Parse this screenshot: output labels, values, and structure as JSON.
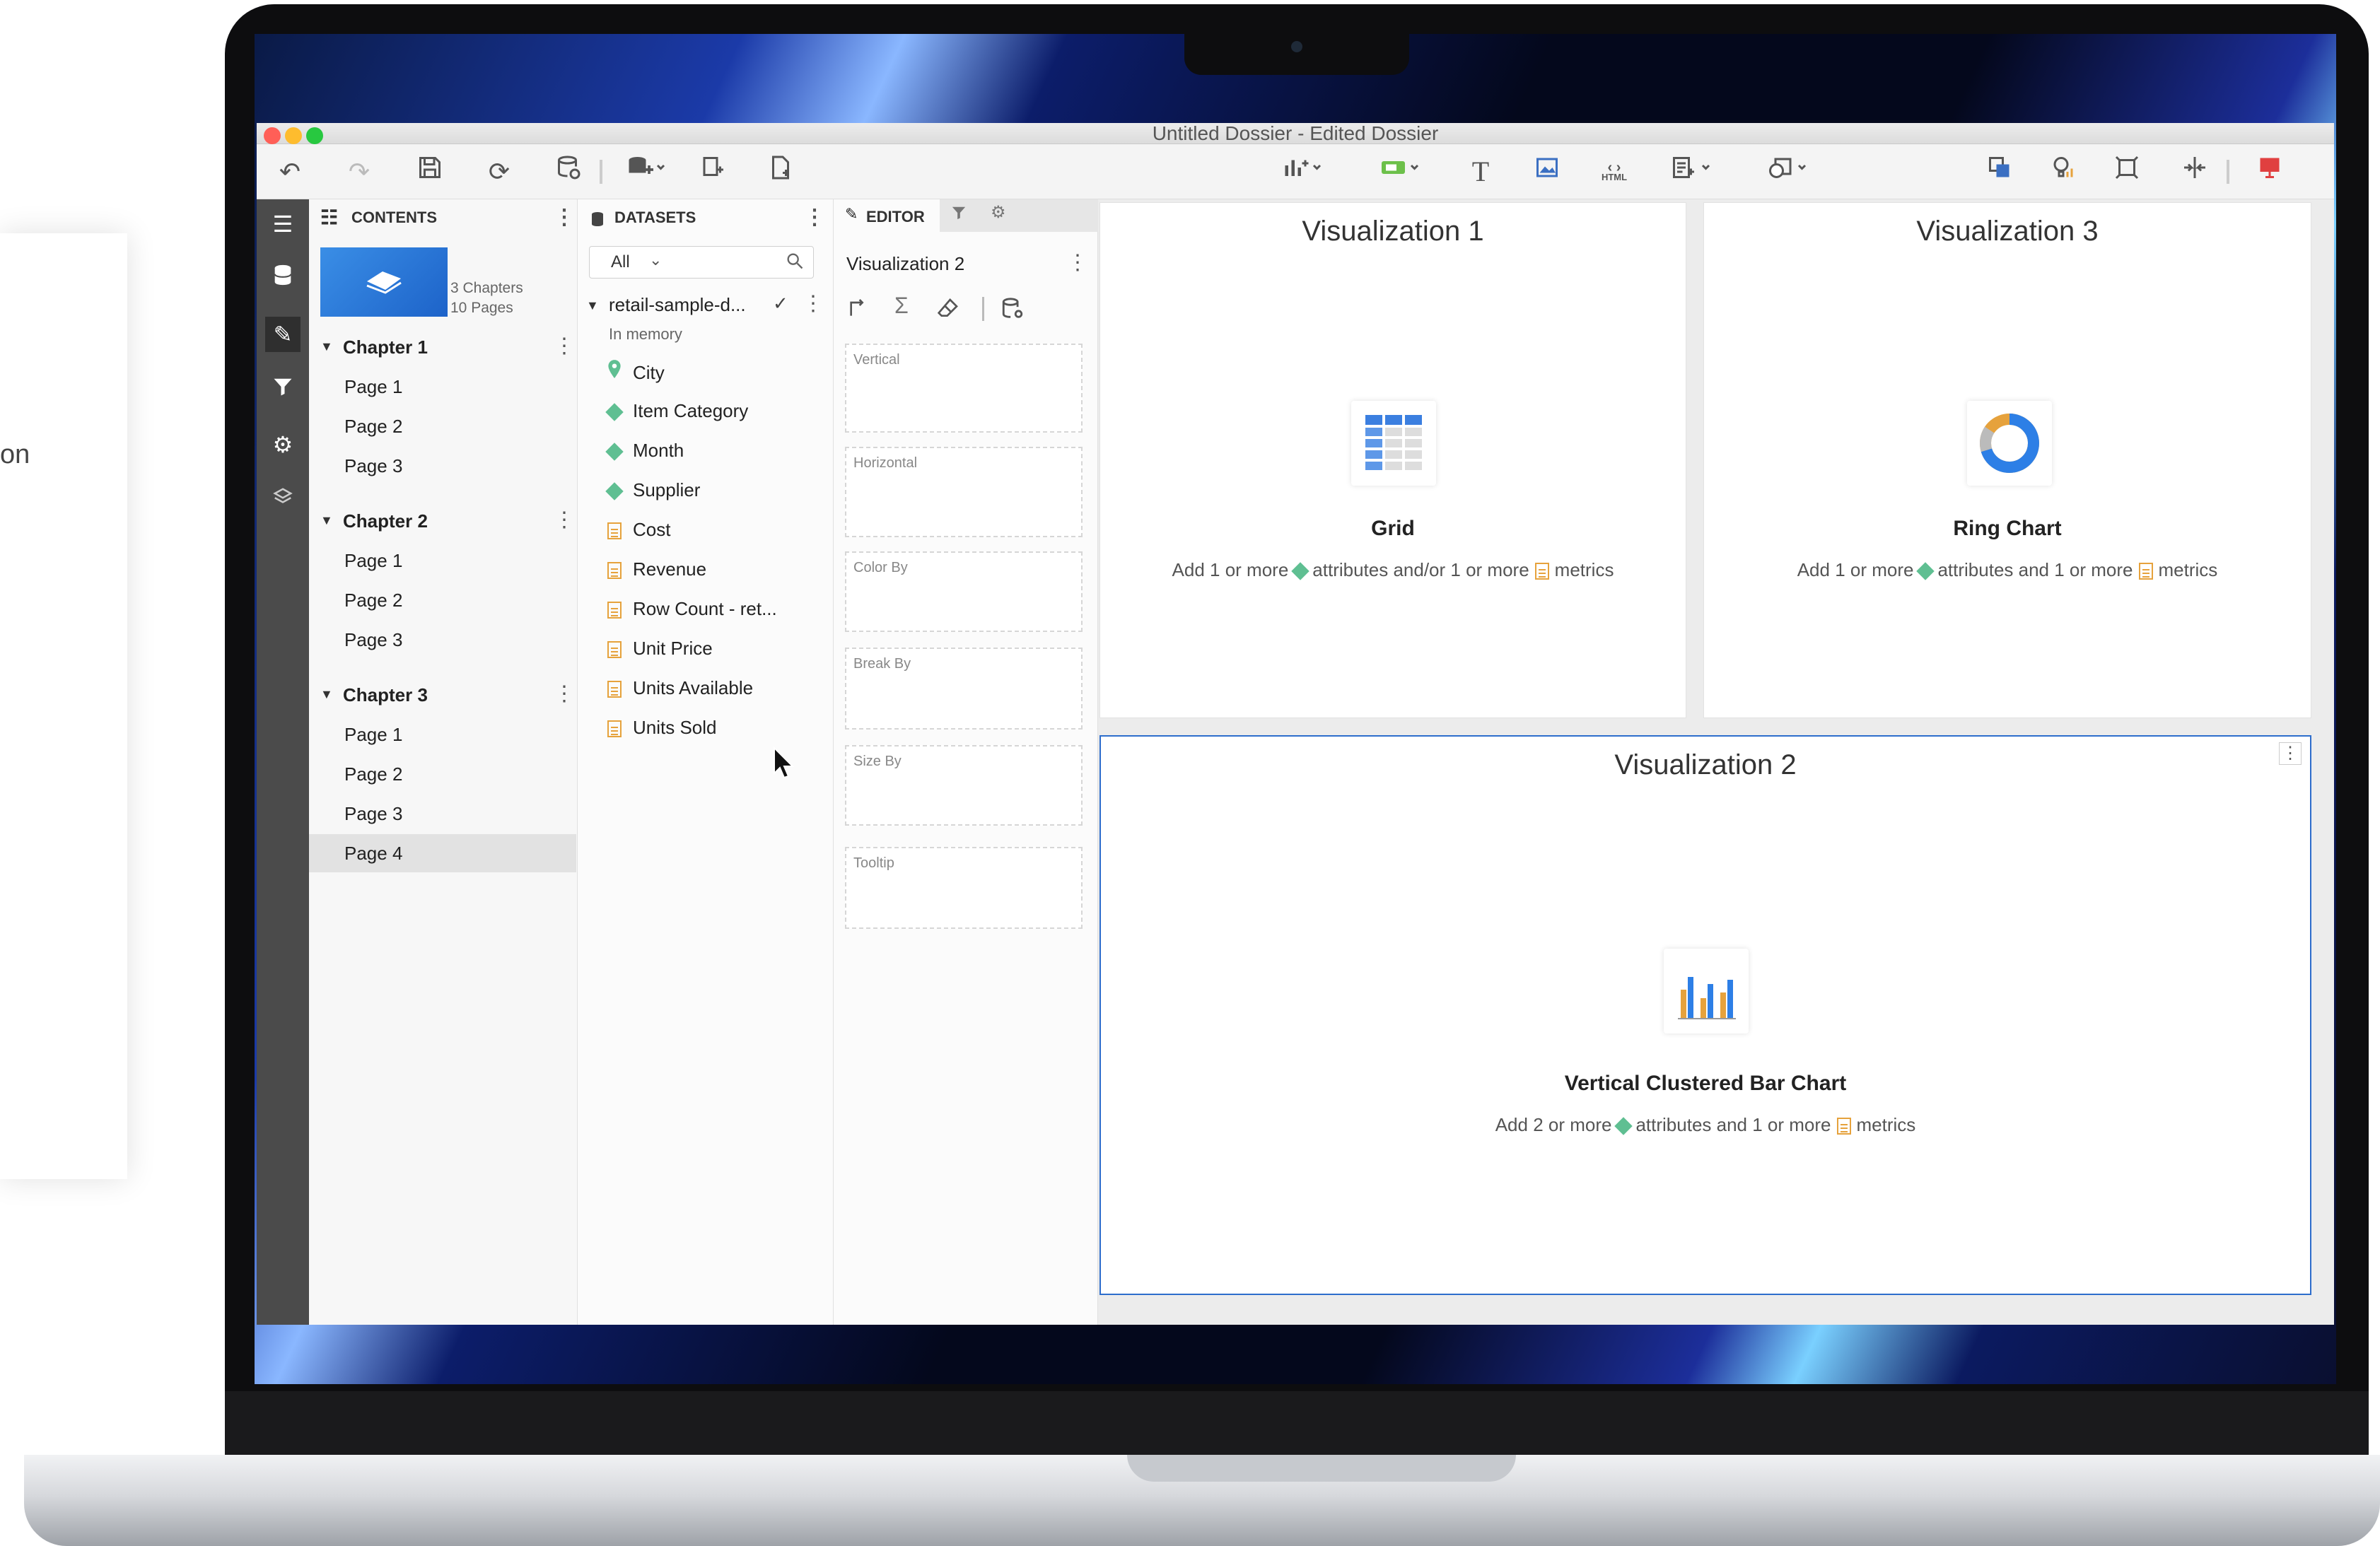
{
  "background": {
    "fragment_text": "on"
  },
  "window": {
    "title": "Untitled Dossier - Edited Dossier"
  },
  "toolbar": {
    "icons": [
      "undo-icon",
      "redo-icon",
      "save-icon",
      "refresh-icon",
      "data-icon",
      "add-data-icon",
      "duplicate-page-icon",
      "new-page-icon",
      "insert-visualization-icon",
      "insert-filter-icon",
      "insert-text-icon",
      "insert-image-icon",
      "insert-html-icon",
      "insert-panel-icon",
      "insert-shape-icon",
      "arrange-icon",
      "insights-icon",
      "fit-icon",
      "responsive-icon",
      "present-icon"
    ],
    "text_button_label": "T",
    "html_button_label": "HTML"
  },
  "contents": {
    "header": "CONTENTS",
    "summary": {
      "chapters": "3 Chapters",
      "pages": "10 Pages"
    },
    "chapters": [
      {
        "name": "Chapter 1",
        "pages": [
          "Page 1",
          "Page 2",
          "Page 3"
        ]
      },
      {
        "name": "Chapter 2",
        "pages": [
          "Page 1",
          "Page 2",
          "Page 3"
        ]
      },
      {
        "name": "Chapter 3",
        "pages": [
          "Page 1",
          "Page 2",
          "Page 3",
          "Page 4"
        ]
      }
    ],
    "selected_page": "Page 4"
  },
  "datasets": {
    "header": "DATASETS",
    "filter_value": "All",
    "dataset_name": "retail-sample-d...",
    "dataset_status": "In memory",
    "fields": [
      {
        "name": "City",
        "type": "geo"
      },
      {
        "name": "Item Category",
        "type": "attribute"
      },
      {
        "name": "Month",
        "type": "attribute"
      },
      {
        "name": "Supplier",
        "type": "attribute"
      },
      {
        "name": "Cost",
        "type": "metric"
      },
      {
        "name": "Revenue",
        "type": "metric"
      },
      {
        "name": "Row Count - ret...",
        "type": "metric"
      },
      {
        "name": "Unit Price",
        "type": "metric"
      },
      {
        "name": "Units Available",
        "type": "metric"
      },
      {
        "name": "Units Sold",
        "type": "metric"
      }
    ]
  },
  "editor": {
    "tab_label": "EDITOR",
    "viz_name": "Visualization 2",
    "zones": [
      "Vertical",
      "Horizontal",
      "Color By",
      "Break By",
      "Size By",
      "Tooltip"
    ]
  },
  "canvas": {
    "viz1": {
      "title": "Visualization 1",
      "type_name": "Grid",
      "hint": {
        "pre": "Add 1 or more",
        "mid": "attributes and/or 1 or more",
        "post": "metrics"
      }
    },
    "viz3": {
      "title": "Visualization 3",
      "type_name": "Ring Chart",
      "hint": {
        "pre": "Add 1 or more",
        "mid": "attributes and 1 or more",
        "post": "metrics"
      }
    },
    "viz2": {
      "title": "Visualization 2",
      "type_name": "Vertical Clustered Bar Chart",
      "hint": {
        "pre": "Add 2 or more",
        "mid": "attributes and 1 or more",
        "post": "metrics"
      }
    }
  },
  "colors": {
    "accent": "#2d6dcc",
    "attribute": "#5fbf92",
    "metric": "#e6a23c",
    "rail": "#4b4b4b"
  }
}
